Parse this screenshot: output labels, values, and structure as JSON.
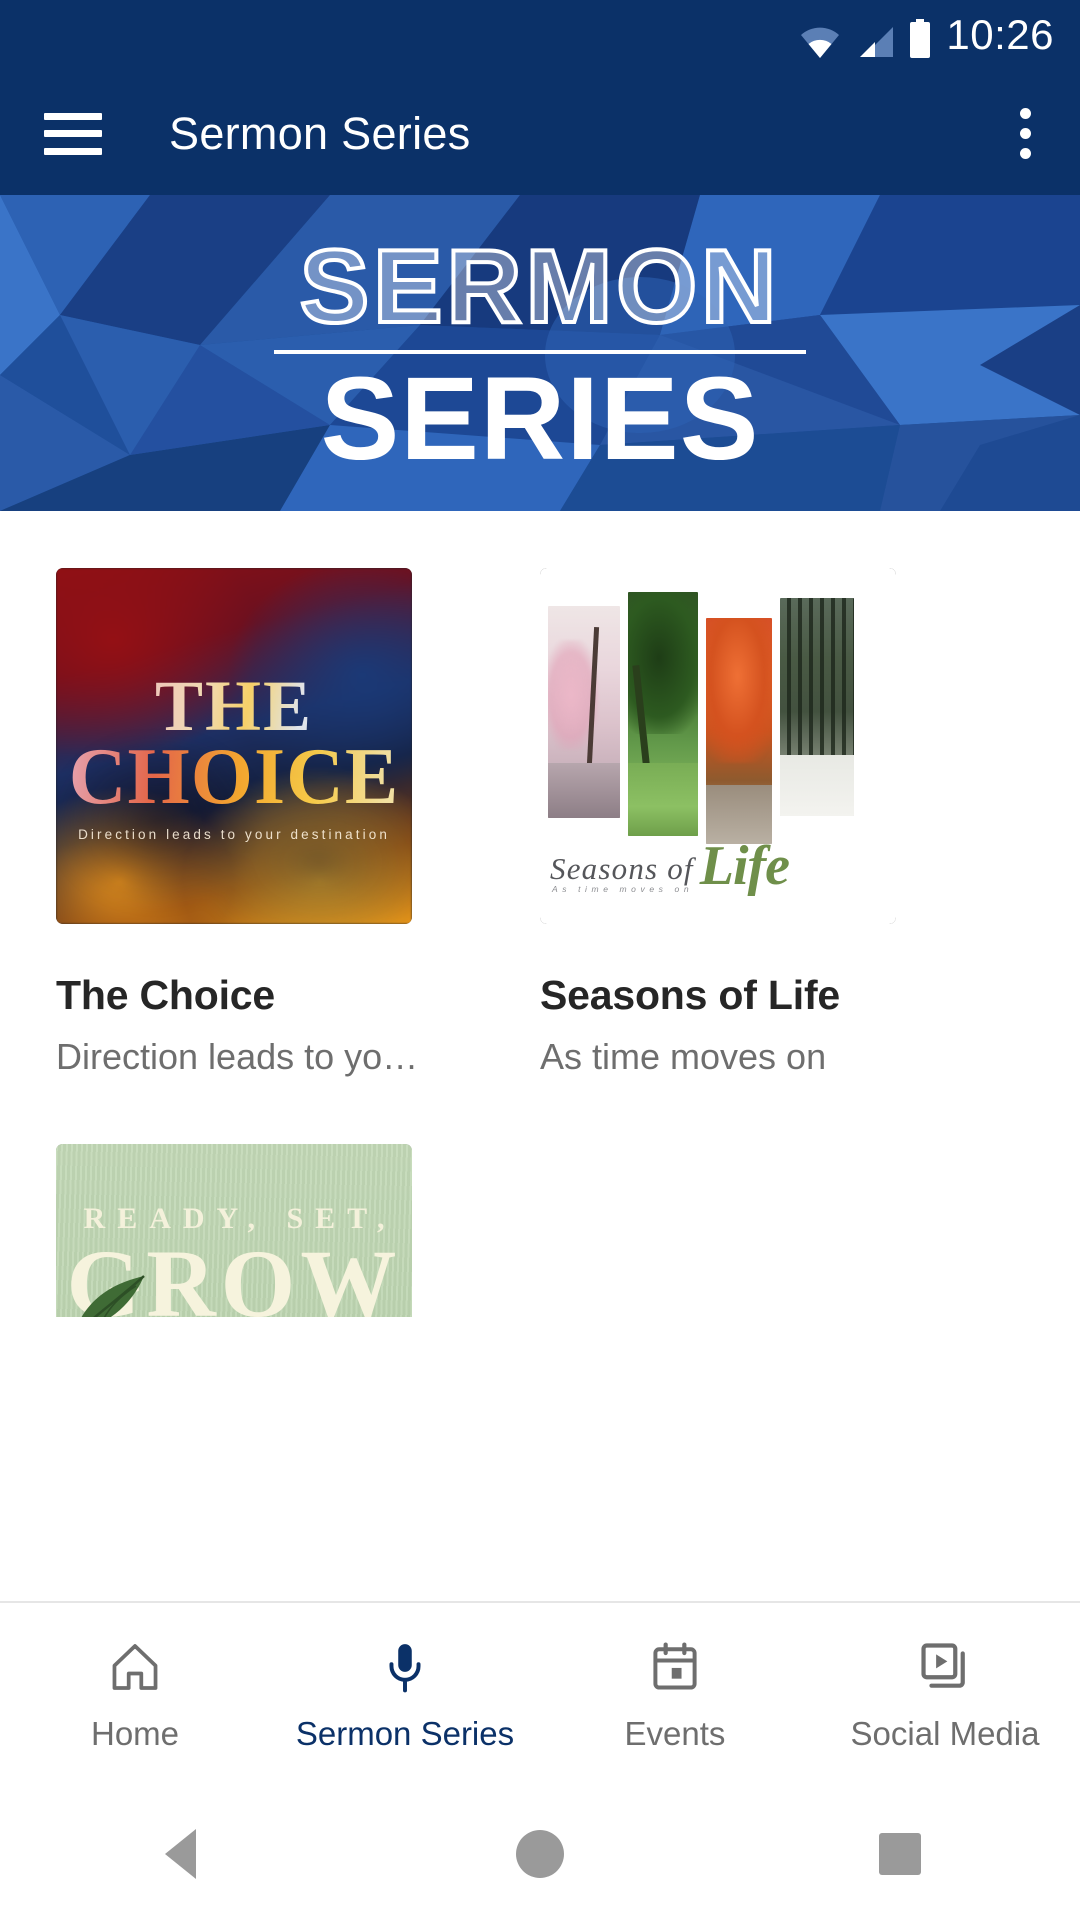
{
  "status_bar": {
    "time": "10:26",
    "icons": [
      "wifi-icon",
      "cellular-signal-icon",
      "battery-icon"
    ],
    "background_color": "#0B3168"
  },
  "app_bar": {
    "menu_icon": "hamburger-menu-icon",
    "title": "Sermon Series",
    "overflow_icon": "more-vertical-icon",
    "background_color": "#0B3168"
  },
  "hero_banner": {
    "line1": "SERMON",
    "line2": "SERIES",
    "style": "low-poly blue geometric background",
    "colors": {
      "base": "#1c4c94",
      "dark": "#14326b",
      "mid": "#2a5fae",
      "light": "#3f7ad0"
    }
  },
  "series_list": [
    {
      "title": "The Choice",
      "subtitle": "Direction leads to yo…",
      "artwork": {
        "name": "the-choice-artwork",
        "line1": "THE",
        "line2": "CHOICE",
        "tagline": "Direction leads to your destination",
        "accent": "#ffae2e"
      }
    },
    {
      "title": "Seasons of Life",
      "subtitle": "As time moves on",
      "artwork": {
        "name": "seasons-of-life-artwork",
        "line1": "Seasons of",
        "line2": "Life",
        "tagline": "As time moves on",
        "accent": "#6f8f4a"
      }
    },
    {
      "title": "Ready, Set, Grow",
      "subtitle": "",
      "artwork": {
        "name": "ready-set-grow-artwork",
        "line1": "READY, SET,",
        "line2": "GROW",
        "tagline": "",
        "accent": "#f6f3dd"
      }
    }
  ],
  "bottom_nav": {
    "active_color": "#0B3168",
    "inactive_color": "#6e6e6e",
    "items": [
      {
        "label": "Home",
        "icon": "home-icon",
        "active": false
      },
      {
        "label": "Sermon Series",
        "icon": "microphone-icon",
        "active": true
      },
      {
        "label": "Events",
        "icon": "calendar-icon",
        "active": false
      },
      {
        "label": "Social Media",
        "icon": "video-library-icon",
        "active": false
      }
    ]
  },
  "android_nav": {
    "back": "back-triangle-icon",
    "home": "home-circle-icon",
    "recents": "recents-square-icon"
  }
}
